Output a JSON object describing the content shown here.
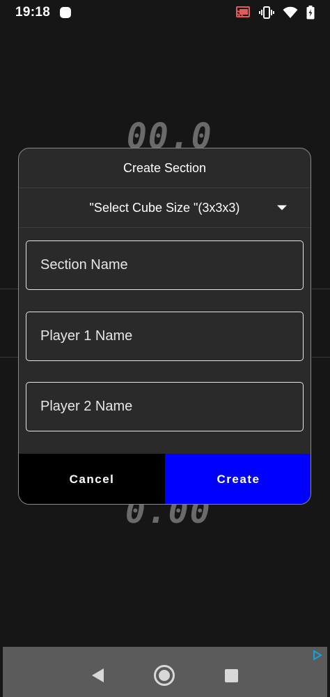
{
  "status_bar": {
    "time": "19:18",
    "icons": [
      "notification-icon",
      "cast-icon",
      "vibrate-icon",
      "wifi-icon",
      "battery-icon"
    ]
  },
  "background": {
    "timer_top": "00.0",
    "timer_bottom": "0.00"
  },
  "dialog": {
    "title": "Create Section",
    "cube_size_select": "\"Select Cube Size \"(3x3x3)",
    "fields": [
      {
        "placeholder": "Section Name",
        "value": ""
      },
      {
        "placeholder": "Player 1 Name",
        "value": ""
      },
      {
        "placeholder": "Player 2 Name",
        "value": ""
      }
    ],
    "cancel_label": "Cancel",
    "create_label": "Create"
  },
  "colors": {
    "create_button": "#0000ff",
    "cancel_button": "#000000",
    "dialog_background": "#2a2a2a"
  },
  "navigation": {
    "icons": [
      "back-icon",
      "home-icon",
      "recents-icon"
    ]
  }
}
